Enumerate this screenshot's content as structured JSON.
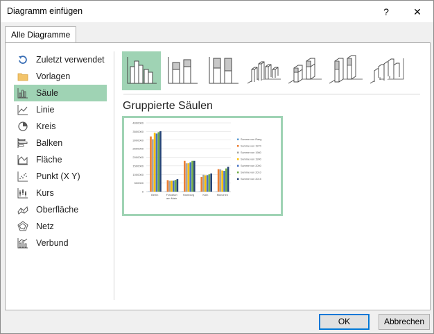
{
  "window": {
    "title": "Diagramm einfügen",
    "help_glyph": "?",
    "close_glyph": "✕"
  },
  "tabs": [
    {
      "label": "Alle Diagramme"
    }
  ],
  "sidebar": {
    "items": [
      {
        "label": "Zuletzt verwendet",
        "icon": "recent-icon"
      },
      {
        "label": "Vorlagen",
        "icon": "folder-icon"
      },
      {
        "label": "Säule",
        "icon": "column-chart-icon",
        "selected": true
      },
      {
        "label": "Linie",
        "icon": "line-chart-icon"
      },
      {
        "label": "Kreis",
        "icon": "pie-chart-icon"
      },
      {
        "label": "Balken",
        "icon": "bar-chart-icon"
      },
      {
        "label": "Fläche",
        "icon": "area-chart-icon"
      },
      {
        "label": "Punkt (X Y)",
        "icon": "scatter-chart-icon"
      },
      {
        "label": "Kurs",
        "icon": "stock-chart-icon"
      },
      {
        "label": "Oberfläche",
        "icon": "surface-chart-icon"
      },
      {
        "label": "Netz",
        "icon": "radar-chart-icon"
      },
      {
        "label": "Verbund",
        "icon": "combo-chart-icon"
      }
    ]
  },
  "subtypes": {
    "selected_index": 0,
    "selected_title": "Gruppierte Säulen",
    "icons": [
      "clustered-column-icon",
      "stacked-column-icon",
      "100-stacked-column-icon",
      "3d-clustered-column-icon",
      "3d-stacked-column-icon",
      "3d-100-stacked-column-icon",
      "3d-column-icon"
    ]
  },
  "chart_data": {
    "type": "bar",
    "categories": [
      "Berlin",
      "Frankfurt am Main",
      "Hamburg",
      "Köln",
      "München"
    ],
    "category_labels": [
      [
        "Berlin"
      ],
      [
        "Frankfurt",
        "am Main"
      ],
      [
        "Hamburg"
      ],
      [
        "Köln"
      ],
      [
        "München"
      ]
    ],
    "ylim": [
      0,
      4000000
    ],
    "yticks": [
      "4000000",
      "3500000",
      "3000000",
      "2500000",
      "2000000",
      "1500000",
      "1000000",
      "500000",
      "0"
    ],
    "ytick_values": [
      4000000,
      3500000,
      3000000,
      2500000,
      2000000,
      1500000,
      1000000,
      500000,
      0
    ],
    "grid": true,
    "legend_position": "right",
    "colors": [
      "#5b9bd5",
      "#ed7d31",
      "#a5a5a5",
      "#ffc000",
      "#4472c4",
      "#70ad47",
      "#264478"
    ],
    "series": [
      {
        "name": "Summe von Rang",
        "values": [
          1,
          5,
          2,
          4,
          3
        ]
      },
      {
        "name": "Summe von 1970",
        "values": [
          3210000,
          670000,
          1790000,
          850000,
          1310000
        ]
      },
      {
        "name": "Summe von 1980",
        "values": [
          3050000,
          630000,
          1650000,
          980000,
          1300000
        ]
      },
      {
        "name": "Summe von 1990",
        "values": [
          3430000,
          640000,
          1650000,
          950000,
          1230000
        ]
      },
      {
        "name": "Summe von 2000",
        "values": [
          3380000,
          640000,
          1710000,
          960000,
          1210000
        ]
      },
      {
        "name": "Summe von 2010",
        "values": [
          3460000,
          680000,
          1790000,
          1010000,
          1350000
        ]
      },
      {
        "name": "Summe von 2015",
        "values": [
          3520000,
          730000,
          1790000,
          1060000,
          1450000
        ]
      }
    ]
  },
  "buttons": {
    "ok": "OK",
    "cancel": "Abbrechen"
  }
}
